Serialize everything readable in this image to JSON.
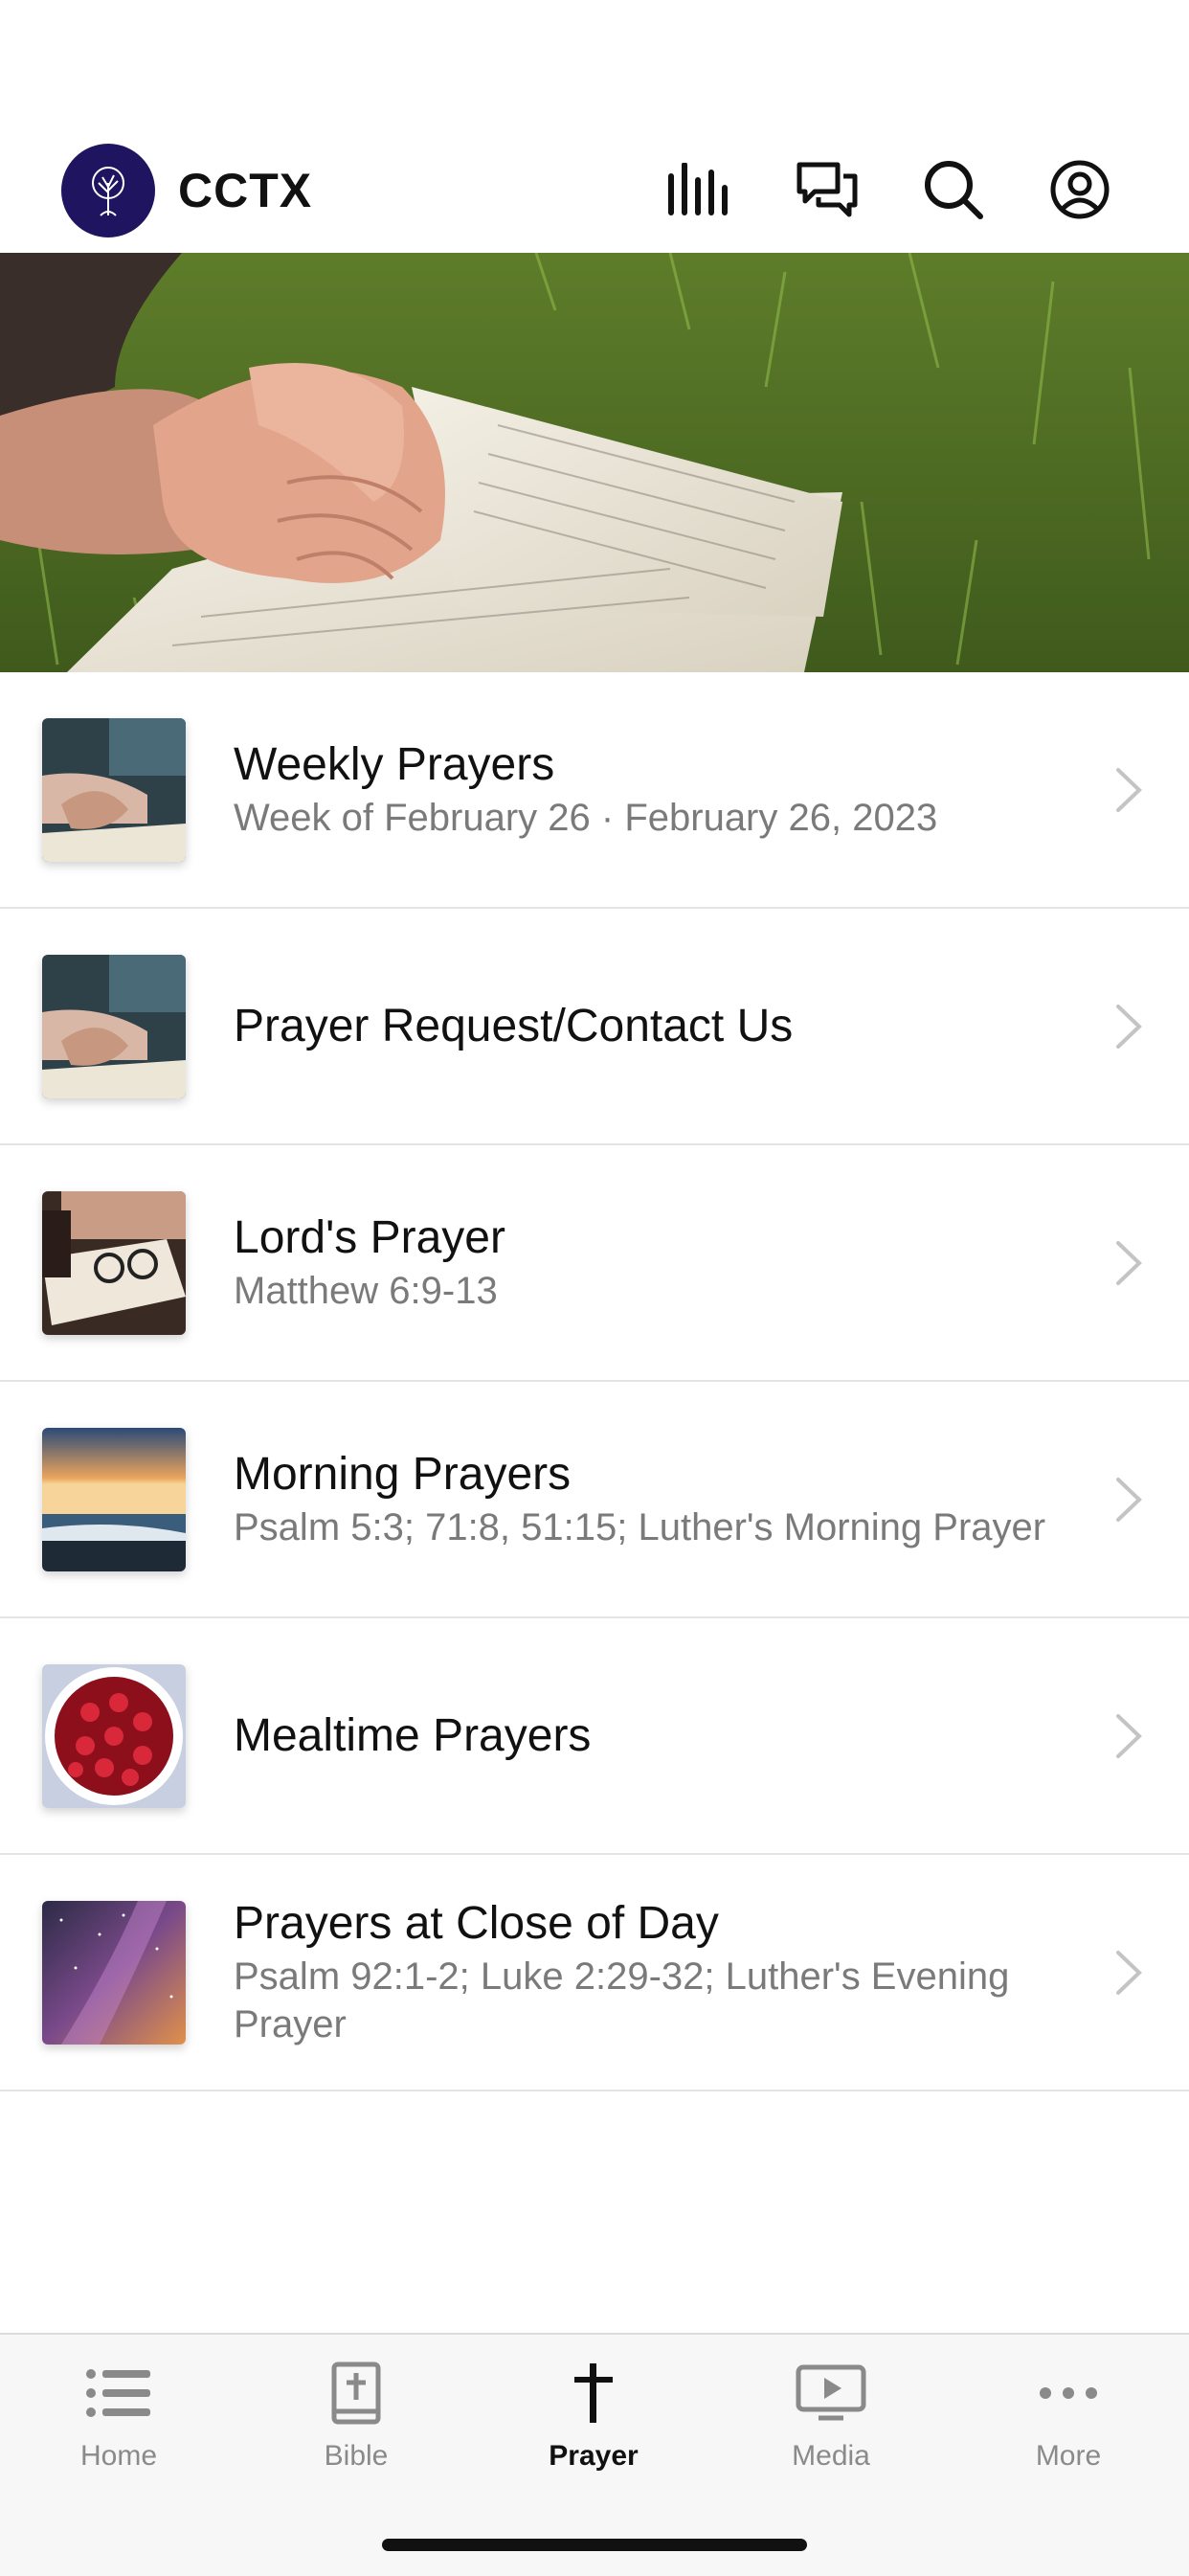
{
  "app": {
    "title": "CCTX",
    "logo_icon": "tree-logo-icon"
  },
  "header_icons": [
    "stats-icon",
    "chat-icon",
    "search-icon",
    "profile-icon"
  ],
  "hero": {
    "image": "praying-hands-on-bible-in-grass"
  },
  "list": [
    {
      "title": "Weekly Prayers",
      "subtitle": "Week of February 26 · February 26, 2023",
      "thumb": "praying-hands"
    },
    {
      "title": "Prayer Request/Contact Us",
      "subtitle": "",
      "thumb": "praying-hands"
    },
    {
      "title": "Lord's Prayer",
      "subtitle": "Matthew 6:9-13",
      "thumb": "bible-glasses"
    },
    {
      "title": "Morning Prayers",
      "subtitle": "Psalm 5:3; 71:8, 51:15; Luther's Morning Prayer",
      "thumb": "sunrise-beach"
    },
    {
      "title": "Mealtime Prayers",
      "subtitle": "",
      "thumb": "cherries-bowl"
    },
    {
      "title": "Prayers at Close of Day",
      "subtitle": "Psalm 92:1-2; Luke 2:29-32; Luther's Evening Prayer",
      "thumb": "night-sky"
    }
  ],
  "tabs": [
    {
      "label": "Home",
      "icon": "list-icon"
    },
    {
      "label": "Bible",
      "icon": "bible-icon"
    },
    {
      "label": "Prayer",
      "icon": "cross-icon",
      "active": true
    },
    {
      "label": "Media",
      "icon": "media-icon"
    },
    {
      "label": "More",
      "icon": "more-icon"
    }
  ],
  "colors": {
    "brand": "#1f1460",
    "active_tab": "#111111",
    "inactive_tab": "#8a8a8a"
  }
}
